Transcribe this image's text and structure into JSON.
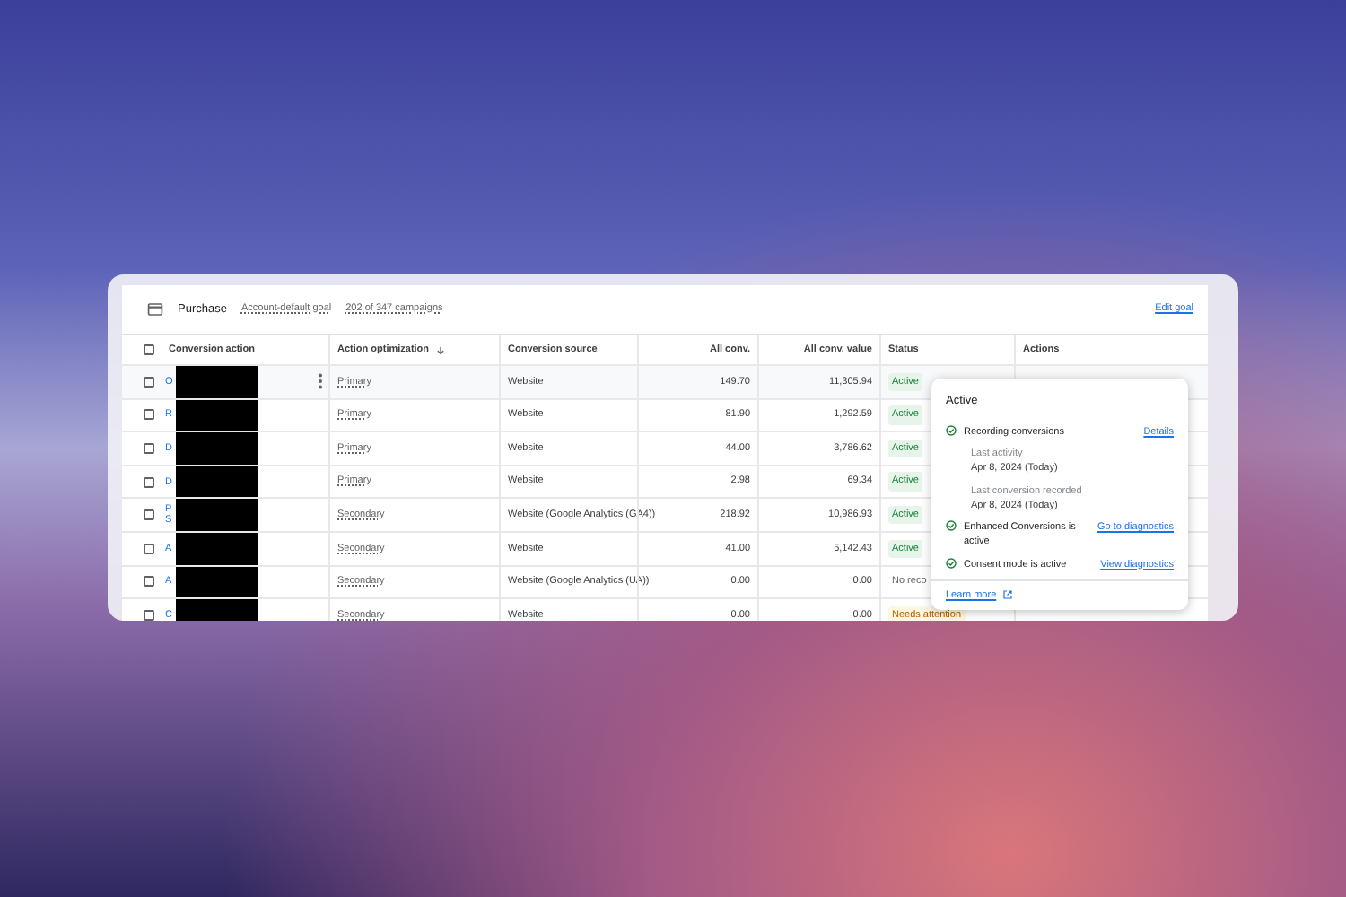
{
  "goal": {
    "title": "Purchase",
    "links": [
      "Account-default goal",
      "202 of 347 campaigns"
    ],
    "edit": "Edit goal"
  },
  "table": {
    "select_all_checked": false,
    "columns": [
      {
        "label": "Conversion action",
        "sorted": false
      },
      {
        "label": "Action optimization",
        "sorted": true
      },
      {
        "label": "Conversion source",
        "sorted": false
      },
      {
        "label": "All conv.",
        "sorted": false
      },
      {
        "label": "All conv. value",
        "sorted": false
      },
      {
        "label": "Status",
        "sorted": false
      },
      {
        "label": "Actions",
        "sorted": false
      }
    ],
    "rows": [
      {
        "checked": false,
        "name": "O",
        "menu": true,
        "optimization": "Primary",
        "source": "Website",
        "conv": "149.70",
        "value": "11,305.94",
        "status": "Active",
        "kind": "active"
      },
      {
        "checked": false,
        "name": "R",
        "menu": false,
        "optimization": "Primary",
        "source": "Website",
        "conv": "81.90",
        "value": "1,292.59",
        "status": "Active",
        "kind": "active"
      },
      {
        "checked": false,
        "name": "D",
        "menu": false,
        "optimization": "Primary",
        "source": "Website",
        "conv": "44.00",
        "value": "3,786.62",
        "status": "Active",
        "kind": "active"
      },
      {
        "checked": false,
        "name": "D",
        "menu": false,
        "optimization": "Primary",
        "source": "Website",
        "conv": "2.98",
        "value": "69.34",
        "status": "Active",
        "kind": "active"
      },
      {
        "checked": false,
        "name": "P S",
        "menu": false,
        "optimization": "Secondary",
        "source": "Website (Google Analytics (GA4))",
        "conv": "218.92",
        "value": "10,986.93",
        "status": "Active",
        "kind": "active"
      },
      {
        "checked": false,
        "name": "A",
        "menu": false,
        "optimization": "Secondary",
        "source": "Website",
        "conv": "41.00",
        "value": "5,142.43",
        "status": "Active",
        "kind": "active"
      },
      {
        "checked": false,
        "name": "A",
        "menu": false,
        "optimization": "Secondary",
        "source": "Website (Google Analytics (UA))",
        "conv": "0.00",
        "value": "0.00",
        "status": "No reco",
        "kind": "none"
      },
      {
        "checked": false,
        "name": "C",
        "menu": false,
        "optimization": "Secondary",
        "source": "Website",
        "conv": "0.00",
        "value": "0.00",
        "status": "Needs attention",
        "kind": "warning"
      }
    ]
  },
  "popover": {
    "title": "Active",
    "items": [
      {
        "label": "Recording conversions",
        "action": "Details",
        "details": [
          {
            "label": "Last activity",
            "value": "Apr 8, 2024 (Today)"
          },
          {
            "label": "Last conversion recorded",
            "value": "Apr 8, 2024 (Today)"
          }
        ]
      },
      {
        "label": "Enhanced Conversions is active",
        "action": "Go to diagnostics"
      },
      {
        "label": "Consent mode is active",
        "action": "View diagnostics"
      }
    ],
    "footer_link": "Learn more"
  }
}
